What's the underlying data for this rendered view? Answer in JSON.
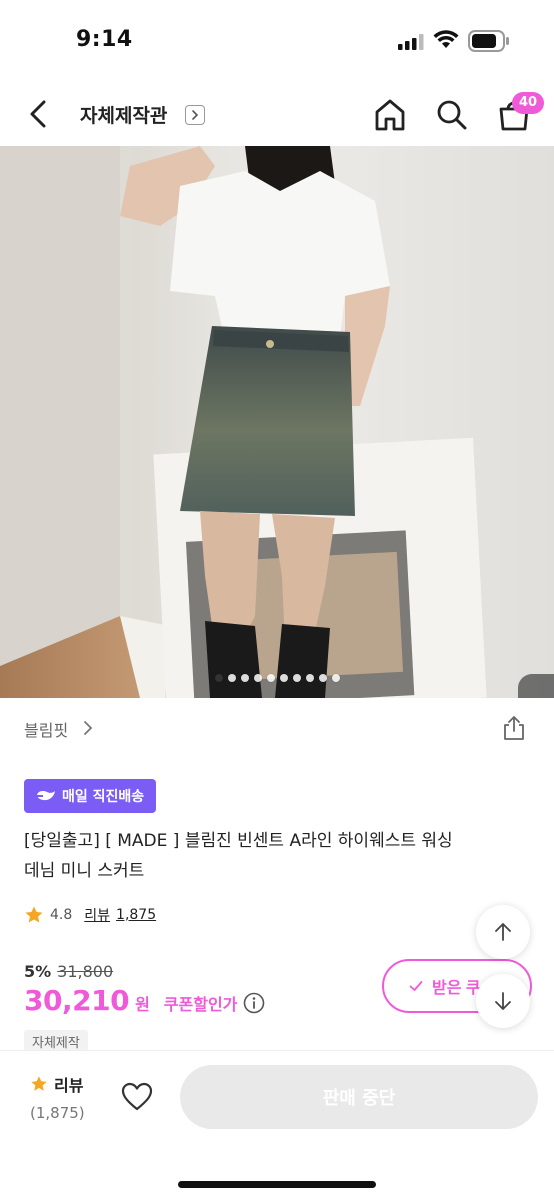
{
  "status_bar": {
    "time": "9:14"
  },
  "header": {
    "title": "자체제작관",
    "cart_count": "40"
  },
  "carousel": {
    "total": 10,
    "active": 0
  },
  "brand": {
    "name": "블림핏"
  },
  "delivery_badge": {
    "label": "매일 직진배송"
  },
  "product": {
    "title_line1": "[당일출고] [ MADE ] 블림진 빈센트 A라인 하이웨스트 워싱",
    "title_line2": "데님 미니 스커트",
    "rating": "4.8",
    "review_label": "리뷰",
    "review_count": "1,875",
    "discount_rate": "5%",
    "original_price": "31,800",
    "sale_price": "30,210",
    "currency": "원",
    "coupon_text": "쿠폰할인가",
    "tag": "자체제작"
  },
  "coupon_button": {
    "label": "받은 쿠"
  },
  "bottom_bar": {
    "review_label": "리뷰",
    "review_count": "(1,875)",
    "cta_label": "판매 중단"
  },
  "colors": {
    "accent": "#f05ad8",
    "badge": "#7b5cf5",
    "star": "#f5a623"
  }
}
